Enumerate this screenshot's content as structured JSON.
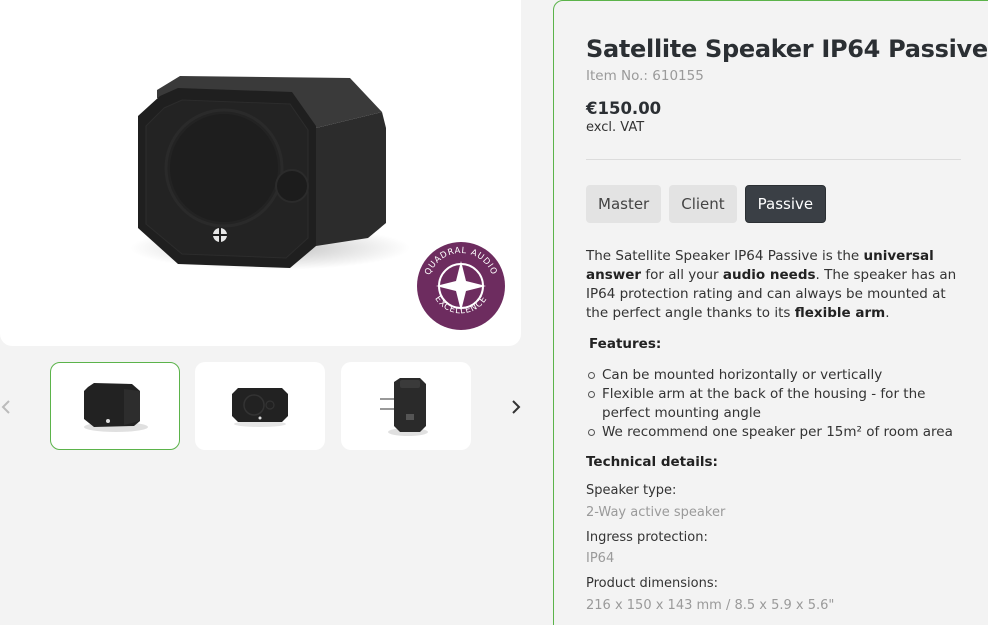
{
  "product": {
    "title": "Satellite Speaker IP64 Passive",
    "item_no": "Item No.: 610155",
    "price": "€150.00",
    "vat": "excl. VAT"
  },
  "badge": {
    "top_text": "QUADRAL AUDIO",
    "bottom_text": "EXCELLENCE",
    "color": "#6d2c5f"
  },
  "variants": [
    {
      "label": "Master",
      "selected": false
    },
    {
      "label": "Client",
      "selected": false
    },
    {
      "label": "Passive",
      "selected": true
    }
  ],
  "description": {
    "p1": "The Satellite Speaker IP64 Passive is the ",
    "b1": "universal answer",
    "p2": " for all your ",
    "b2": "audio needs",
    "p3": ". The speaker has an IP64 protection rating and can always be mounted at the perfect angle thanks to its ",
    "b3": "flexible arm",
    "p4": "."
  },
  "features": {
    "heading": "Features:",
    "items": [
      "Can be mounted horizontally or vertically",
      "Flexible arm at the back of the housing - for the perfect mounting angle",
      "We recommend one speaker per 15m² of room area"
    ]
  },
  "technical": {
    "heading": "Technical details:",
    "specs": [
      {
        "label": "Speaker type:",
        "value": "2-Way active speaker"
      },
      {
        "label": "Ingress protection:",
        "value": "IP64"
      },
      {
        "label": "Product dimensions:",
        "value": "216 x 150 x 143 mm / 8.5 x 5.9 x 5.6\""
      }
    ]
  },
  "gallery": {
    "prev_icon": "chevron-left-icon",
    "next_icon": "chevron-right-icon",
    "active_thumb": 0
  },
  "colors": {
    "accent": "#5bb34a",
    "selected_variant": "#3a3f45"
  }
}
